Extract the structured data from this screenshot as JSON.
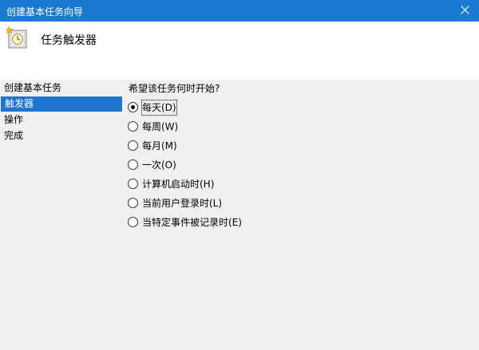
{
  "window": {
    "title": "创建基本任务向导",
    "close_glyph": "✕"
  },
  "header": {
    "title": "任务触发器",
    "icon": "wizard-clock-icon"
  },
  "sidebar": {
    "steps": [
      {
        "label": "创建基本任务"
      },
      {
        "label": "触发器",
        "active": true
      },
      {
        "label": "操作"
      },
      {
        "label": "完成"
      }
    ]
  },
  "main": {
    "question": "希望该任务何时开始?",
    "options": [
      {
        "label": "每天(D)",
        "checked": true
      },
      {
        "label": "每周(W)"
      },
      {
        "label": "每月(M)"
      },
      {
        "label": "一次(O)"
      },
      {
        "label": "计算机启动时(H)"
      },
      {
        "label": "当前用户登录时(L)"
      },
      {
        "label": "当特定事件被记录时(E)"
      }
    ]
  },
  "colors": {
    "titlebar": "#1a7ad2",
    "selection": "#1f73d1",
    "panel": "#f0f0f0",
    "header": "#ffffff"
  }
}
